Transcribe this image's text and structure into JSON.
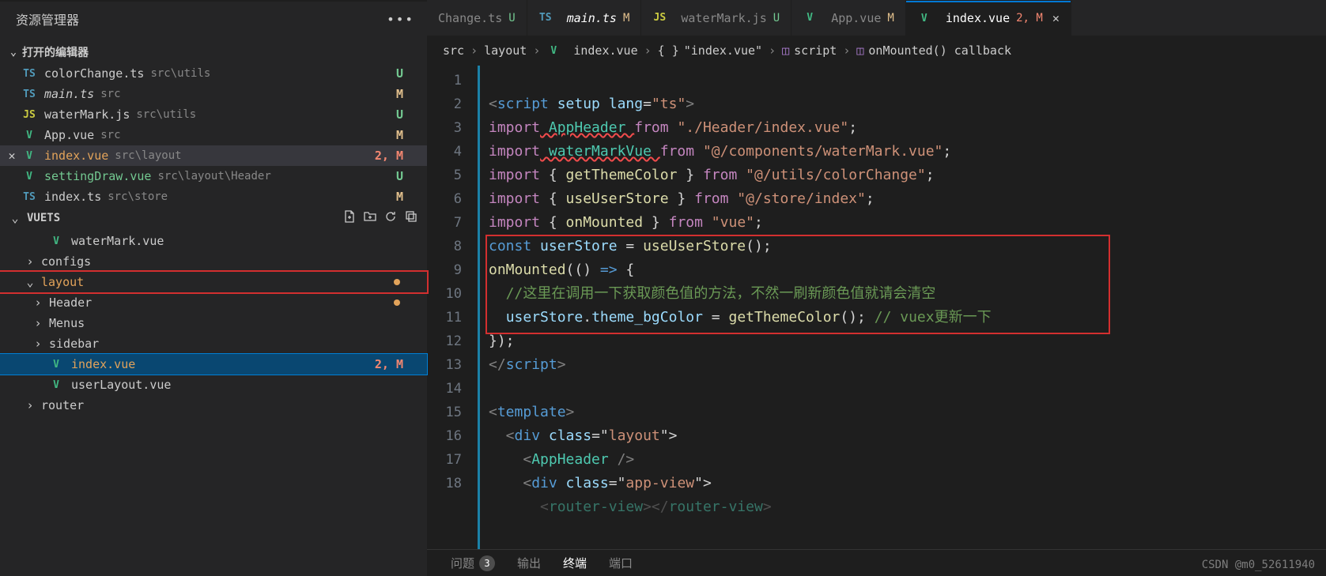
{
  "sidebar": {
    "title": "资源管理器",
    "open_editors_title": "打开的编辑器",
    "editors": [
      {
        "icon": "ts",
        "name": "colorChange.ts",
        "path": "src\\utils",
        "status": "U",
        "statcls": "u"
      },
      {
        "icon": "ts",
        "name": "main.ts",
        "path": "src",
        "status": "M",
        "statcls": "m",
        "italic": true
      },
      {
        "icon": "js",
        "name": "waterMark.js",
        "path": "src\\utils",
        "status": "U",
        "statcls": "u"
      },
      {
        "icon": "vue",
        "name": "App.vue",
        "path": "src",
        "status": "M",
        "statcls": "m"
      },
      {
        "icon": "vue",
        "name": "index.vue",
        "path": "src\\layout",
        "status": "2, M",
        "statcls": "err",
        "active": true,
        "orange": true,
        "close": true
      },
      {
        "icon": "vue",
        "name": "settingDraw.vue",
        "path": "src\\layout\\Header",
        "status": "U",
        "statcls": "u",
        "green": true
      },
      {
        "icon": "ts",
        "name": "index.ts",
        "path": "src\\store",
        "status": "M",
        "statcls": "m"
      }
    ],
    "project_name": "VUETS",
    "tree": [
      {
        "type": "file",
        "depth": 1,
        "icon": "vue",
        "name": "waterMark.vue",
        "arrow": ""
      },
      {
        "type": "folder",
        "depth": 0,
        "name": "configs",
        "arrow": "›"
      },
      {
        "type": "folder",
        "depth": 0,
        "name": "layout",
        "arrow": "⌄",
        "orange": true,
        "dot": true,
        "redbox": true
      },
      {
        "type": "folder",
        "depth": 1,
        "name": "Header",
        "arrow": "›",
        "dot": true
      },
      {
        "type": "folder",
        "depth": 1,
        "name": "Menus",
        "arrow": "›"
      },
      {
        "type": "folder",
        "depth": 1,
        "name": "sidebar",
        "arrow": "›"
      },
      {
        "type": "file",
        "depth": 1,
        "icon": "vue",
        "name": "index.vue",
        "status": "2, M",
        "statcls": "err",
        "sel": true,
        "orange": true,
        "redbox": true
      },
      {
        "type": "file",
        "depth": 1,
        "icon": "vue",
        "name": "userLayout.vue"
      },
      {
        "type": "folder",
        "depth": 0,
        "name": "router",
        "arrow": "›"
      }
    ]
  },
  "tabs": [
    {
      "icon": "",
      "name": "Change.ts",
      "stat": "U",
      "statcls": "u",
      "partial": true
    },
    {
      "icon": "ts",
      "name": "main.ts",
      "stat": "M",
      "statcls": "m",
      "italic": true
    },
    {
      "icon": "js",
      "name": "waterMark.js",
      "stat": "U",
      "statcls": "u"
    },
    {
      "icon": "vue",
      "name": "App.vue",
      "stat": "M",
      "statcls": "m"
    },
    {
      "icon": "vue",
      "name": "index.vue",
      "stat": "2, M",
      "statcls": "err",
      "active": true,
      "close": true
    }
  ],
  "breadcrumbs": {
    "c0": "src",
    "c1": "layout",
    "c2": "index.vue",
    "c3": "\"index.vue\"",
    "c4": "script",
    "c5": "onMounted() callback"
  },
  "code": {
    "lines": [
      "1",
      "2",
      "3",
      "4",
      "5",
      "6",
      "7",
      "8",
      "9",
      "10",
      "11",
      "12",
      "13",
      "14",
      "15",
      "16",
      "17",
      "18"
    ],
    "l1_a": "<",
    "l1_b": "script",
    "l1_c": " setup lang",
    "l1_d": "=",
    "l1_e": "\"ts\"",
    "l1_f": ">",
    "l2_a": "import",
    "l2_b": " AppHeader ",
    "l2_c": "from",
    "l2_d": " \"./Header/index.vue\"",
    "l2_e": ";",
    "l3_a": "import",
    "l3_b": " waterMarkVue ",
    "l3_c": "from",
    "l3_d": " \"@/components/waterMark.vue\"",
    "l3_e": ";",
    "l4_a": "import",
    "l4_b": " { ",
    "l4_c": "getThemeColor",
    "l4_d": " } ",
    "l4_e": "from",
    "l4_f": " \"@/utils/colorChange\"",
    "l4_g": ";",
    "l5_a": "import",
    "l5_b": " { ",
    "l5_c": "useUserStore",
    "l5_d": " } ",
    "l5_e": "from",
    "l5_f": " \"@/store/index\"",
    "l5_g": ";",
    "l6_a": "import",
    "l6_b": " { ",
    "l6_c": "onMounted",
    "l6_d": " } ",
    "l6_e": "from",
    "l6_f": " \"vue\"",
    "l6_g": ";",
    "l7_a": "const",
    "l7_b": " userStore ",
    "l7_c": "= ",
    "l7_d": "useUserStore",
    "l7_e": "();",
    "l8_a": "onMounted",
    "l8_b": "(() ",
    "l8_c": "=>",
    "l8_d": " {",
    "l9_a": "  //这里在调用一下获取颜色值的方法，不然一刷新颜色值就请会清空",
    "l10_a": "  ",
    "l10_b": "userStore",
    "l10_c": ".",
    "l10_d": "theme_bgColor",
    "l10_e": " = ",
    "l10_f": "getThemeColor",
    "l10_g": "(); ",
    "l10_h": "// vuex更新一下",
    "l11_a": "});",
    "l12_a": "</",
    "l12_b": "script",
    "l12_c": ">",
    "l14_a": "<",
    "l14_b": "template",
    "l14_c": ">",
    "l15_a": "  <",
    "l15_b": "div",
    "l15_c": " class",
    "l15_d": "=\"",
    "l15_e": "layout",
    "l15_f": "\">",
    "l16_a": "    <",
    "l16_b": "AppHeader",
    "l16_c": " />",
    "l17_a": "    <",
    "l17_b": "div",
    "l17_c": " class",
    "l17_d": "=\"",
    "l17_e": "app-view",
    "l17_f": "\">",
    "l18_a": "      <",
    "l18_b": "router-view",
    "l18_c": "></",
    "l18_d": "router-view",
    "l18_e": ">"
  },
  "panel": {
    "p0": "问题",
    "p0badge": "3",
    "p1": "输出",
    "p2": "终端",
    "p3": "端口"
  },
  "watermark": "CSDN @m0_52611940"
}
